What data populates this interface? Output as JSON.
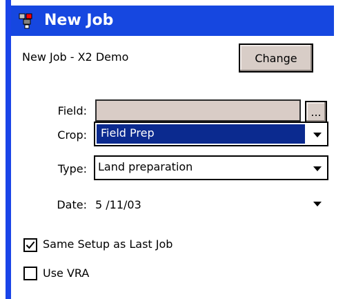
{
  "window": {
    "title": "New Job",
    "title_bar_color": "#1647e0"
  },
  "header": {
    "job_name": "New Job - X2 Demo",
    "change_button": "Change"
  },
  "form": {
    "field": {
      "label": "Field:",
      "value": "",
      "browse_button": "..."
    },
    "crop": {
      "label": "Crop:",
      "value": "Field Prep",
      "selected_highlight": "#0b2a8f"
    },
    "type": {
      "label": "Type:",
      "value": "Land preparation"
    },
    "date": {
      "label": "Date:",
      "value": "5 /11/03"
    }
  },
  "options": {
    "same_setup": {
      "label": "Same Setup as Last Job",
      "checked": true
    },
    "use_vra": {
      "label": "Use VRA",
      "checked": false
    }
  },
  "icons": {
    "title": "job-icon",
    "combo_arrow": "chevron-down-icon",
    "check": "checkmark-icon"
  }
}
